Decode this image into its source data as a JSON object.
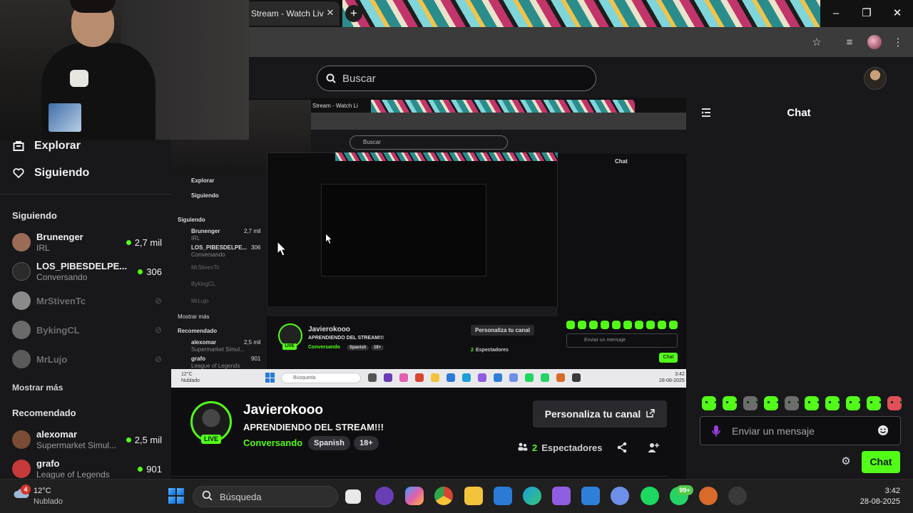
{
  "browser": {
    "tab_title": "Stream - Watch Liv",
    "tab_close": "✕",
    "new_tab": "+",
    "window_controls": [
      "minimize-icon",
      "restore-icon",
      "close-icon"
    ],
    "toolbar_icons": [
      "star-icon",
      "media-icon",
      "profile-icon",
      "menu-icon"
    ]
  },
  "header": {
    "search_placeholder": "Buscar"
  },
  "sidebar": {
    "nav": [
      {
        "label": "Explorar",
        "icon": "explore-icon"
      },
      {
        "label": "Siguiendo",
        "icon": "heart-icon"
      }
    ],
    "following_title": "Siguiendo",
    "following": [
      {
        "name": "Brunenger",
        "sub": "IRL",
        "viewers": "2,7 mil",
        "online": true,
        "color": "#9a6b55"
      },
      {
        "name": "LOS_PIBESDELPE...",
        "sub": "Conversando",
        "viewers": "306",
        "online": true,
        "color": "#2b2b2b"
      },
      {
        "name": "MrStivenTc",
        "sub": "",
        "viewers": "",
        "online": false,
        "color": "#8a8a8a"
      },
      {
        "name": "BykingCL",
        "sub": "",
        "viewers": "",
        "online": false,
        "color": "#6a6a6a"
      },
      {
        "name": "MrLujo",
        "sub": "",
        "viewers": "",
        "online": false,
        "color": "#5a5a5a"
      }
    ],
    "show_more": "Mostrar más",
    "recommended_title": "Recomendado",
    "recommended": [
      {
        "name": "alexomar",
        "sub": "Supermarket Simul...",
        "viewers": "2,5 mil",
        "color": "#7b4c35"
      },
      {
        "name": "grafo",
        "sub": "League of Legends",
        "viewers": "901",
        "color": "#c73a3a"
      }
    ]
  },
  "nested_capture": {
    "tab_title": "Stream - Watch Li",
    "search": "Buscar",
    "chat_title": "Chat",
    "nav": [
      "Explorar",
      "Siguiendo"
    ],
    "following_title": "Siguiendo",
    "following": [
      {
        "name": "Brunenger",
        "sub": "IRL",
        "viewers": "2,7 mil"
      },
      {
        "name": "LOS_PIBESDELPE...",
        "sub": "Conversando",
        "viewers": "306"
      },
      {
        "name": "MrStivenTc",
        "sub": "",
        "viewers": ""
      },
      {
        "name": "BykingCL",
        "sub": "",
        "viewers": ""
      },
      {
        "name": "MrLujo",
        "sub": "",
        "viewers": ""
      }
    ],
    "show_more": "Mostrar más",
    "recommended_title": "Recomendado",
    "recommended": [
      {
        "name": "alexomar",
        "sub": "Supermarket Simul...",
        "viewers": "2,5 mil"
      },
      {
        "name": "grafo",
        "sub": "League of Legends",
        "viewers": "901"
      }
    ],
    "streamer": "Javierokooo",
    "title": "APRENDIENDO DEL STREAM!!!",
    "category": "Conversando",
    "tags": [
      "Spanish",
      "18+"
    ],
    "customize": "Personaliza tu canal",
    "viewers_count": "2",
    "viewers_label": "Espectadores",
    "chat_placeholder": "Enviar un mensaje",
    "chat_button": "Chat",
    "live": "LIVE",
    "taskbar_search": "Búsqueda",
    "weather_temp": "12°C",
    "weather_cond": "Nublado",
    "time": "3:42",
    "date": "28-08-2025"
  },
  "chat": {
    "title": "Chat",
    "input_placeholder": "Enviar un mensaje",
    "send_label": "Chat",
    "emotes": [
      "emote-1",
      "emote-2",
      "emote-3",
      "emote-4",
      "emote-5",
      "emote-6",
      "emote-7",
      "emote-8",
      "emote-9",
      "emote-10"
    ]
  },
  "stream": {
    "streamer": "Javierokooo",
    "live_label": "LIVE",
    "title": "APRENDIENDO DEL STREAM!!!",
    "category": "Conversando",
    "tags": [
      "Spanish",
      "18+"
    ],
    "customize_label": "Personaliza tu canal",
    "viewers_count": "2",
    "viewers_label": "Espectadores"
  },
  "taskbar": {
    "weather_badge": "4",
    "temp": "12°C",
    "condition": "Nublado",
    "search_placeholder": "Búsqueda",
    "whatsapp_badge": "99+",
    "time": "3:42",
    "date": "28-08-2025",
    "apps": [
      {
        "name": "task-view-icon",
        "color": "#e8e8e8"
      },
      {
        "name": "media-player-icon",
        "color": "#6a3db5"
      },
      {
        "name": "copilot-icon",
        "color": "#e15fae"
      },
      {
        "name": "chrome-icon",
        "color": "#d64532"
      },
      {
        "name": "file-explorer-icon",
        "color": "#f3c33b"
      },
      {
        "name": "outlook-icon",
        "color": "#2a7ad6"
      },
      {
        "name": "edge-icon",
        "color": "#1a9fd8"
      },
      {
        "name": "store-like-icon",
        "color": "#8f5de0"
      },
      {
        "name": "microsoft-store-icon",
        "color": "#2f7fd8"
      },
      {
        "name": "app-icon",
        "color": "#6e8fe8"
      },
      {
        "name": "spotify-icon",
        "color": "#1ed760"
      },
      {
        "name": "whatsapp-icon",
        "color": "#25d366"
      },
      {
        "name": "firefox-like-icon",
        "color": "#d86a2a"
      },
      {
        "name": "obs-like-icon",
        "color": "#3a3a3a"
      }
    ]
  }
}
